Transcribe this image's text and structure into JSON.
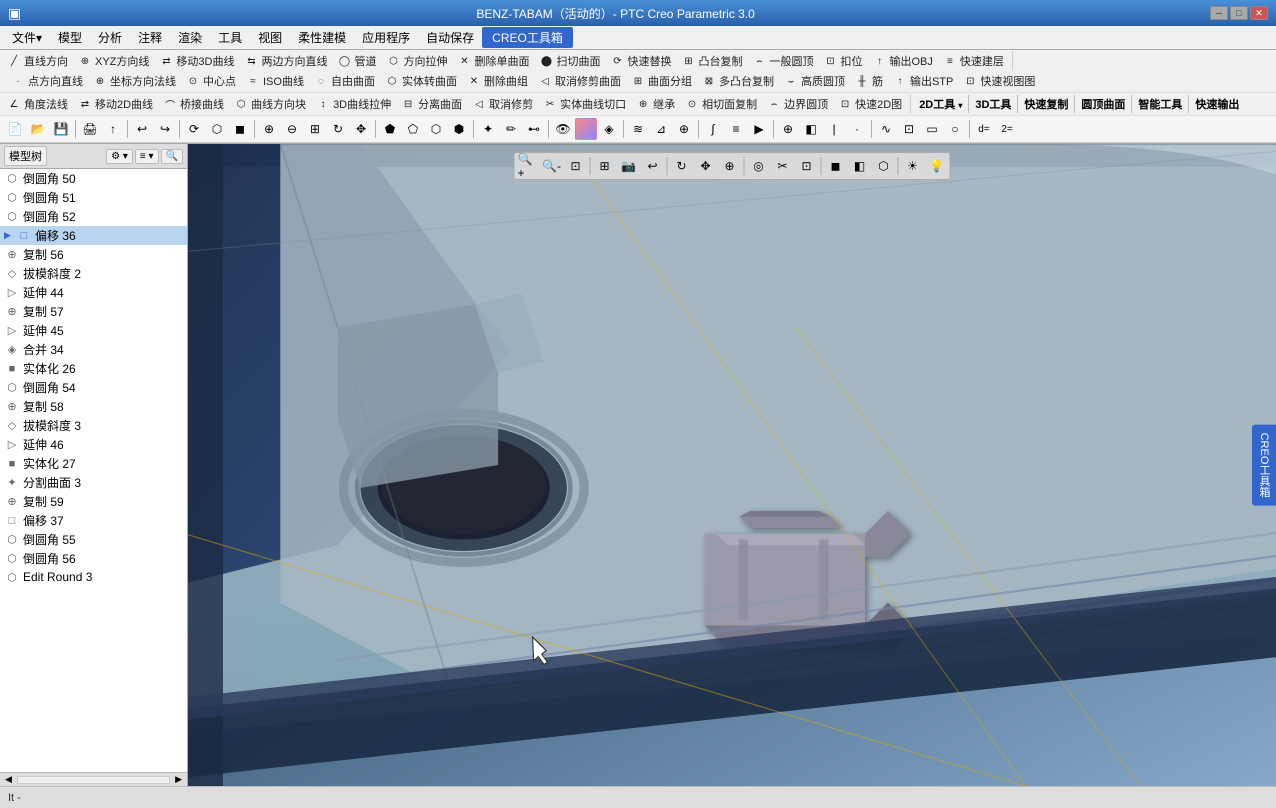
{
  "titlebar": {
    "title": "BENZ-TABAM（活动的）- PTC Creo Parametric 3.0",
    "icon": "▣"
  },
  "menubar": {
    "items": [
      "文件▾",
      "模型",
      "分析",
      "注释",
      "渲染",
      "工具",
      "视图",
      "柔性建模",
      "应用程序",
      "自动保存",
      "CREO工具箱"
    ]
  },
  "toolbar": {
    "row1": {
      "section_2d": "2D工具",
      "section_3d": "3D工具",
      "section_copy": "快速复制",
      "section_curve": "圆顶曲面",
      "section_smart": "智能工具",
      "section_output": "快速输出",
      "tools_2d": [
        "直线方向",
        "XYZ方向线",
        "移动3D曲线",
        "两边方向直线",
        "管道",
        "方向拉伸",
        "删除单曲面",
        "扫切曲面",
        "快速替换",
        "凸台复制",
        "一般圆顶",
        "扣位",
        "输出OBJ",
        "快速建层",
        "点方向直线",
        "坐标方向法线",
        "中心点",
        "ISO曲线",
        "自由曲面",
        "实体转曲面",
        "删除曲组",
        "取消修剪曲面",
        "曲面分组",
        "多凸台复制",
        "高质圆顶",
        "筋",
        "输出STP",
        "快速视图图",
        "角度法线",
        "移动2D曲线",
        "桥接曲线",
        "曲线方向块",
        "3D曲线拉伸",
        "分离曲面",
        "取消修剪",
        "实体曲线切口",
        "继承",
        "相切面复制",
        "边界圆顶",
        "快速2D图"
      ]
    },
    "row2_icons": [
      "new",
      "open",
      "save",
      "print",
      "undo",
      "redo",
      "zoom_in",
      "zoom_out",
      "rotate",
      "pan",
      "wireframe",
      "shading"
    ]
  },
  "model_tree": {
    "label": "模型树",
    "items": [
      {
        "id": "chamfer50",
        "label": "倒圆角 50",
        "icon": "⬡",
        "indent": 0
      },
      {
        "id": "chamfer51",
        "label": "倒圆角 51",
        "icon": "⬡",
        "indent": 0
      },
      {
        "id": "chamfer52",
        "label": "倒圆角 52",
        "icon": "⬡",
        "indent": 0
      },
      {
        "id": "offset36",
        "label": "偏移 36",
        "icon": "□",
        "indent": 0,
        "active": true
      },
      {
        "id": "copy56",
        "label": "复制 56",
        "icon": "⊕",
        "indent": 0
      },
      {
        "id": "draft2",
        "label": "拔模斜度 2",
        "icon": "◇",
        "indent": 0
      },
      {
        "id": "extrude44",
        "label": "延伸 44",
        "icon": "▷",
        "indent": 0
      },
      {
        "id": "copy57",
        "label": "复制 57",
        "icon": "⊕",
        "indent": 0
      },
      {
        "id": "extrude45",
        "label": "延伸 45",
        "icon": "▷",
        "indent": 0
      },
      {
        "id": "merge34",
        "label": "合并 34",
        "icon": "◈",
        "indent": 0
      },
      {
        "id": "solid26",
        "label": "实体化 26",
        "icon": "■",
        "indent": 0
      },
      {
        "id": "chamfer54",
        "label": "倒圆角 54",
        "icon": "⬡",
        "indent": 0
      },
      {
        "id": "copy58",
        "label": "复制 58",
        "icon": "⊕",
        "indent": 0
      },
      {
        "id": "draft3",
        "label": "拔模斜度 3",
        "icon": "◇",
        "indent": 0
      },
      {
        "id": "extrude46",
        "label": "延伸 46",
        "icon": "▷",
        "indent": 0
      },
      {
        "id": "solid27",
        "label": "实体化 27",
        "icon": "■",
        "indent": 0
      },
      {
        "id": "split3",
        "label": "分割曲面 3",
        "icon": "✦",
        "indent": 0
      },
      {
        "id": "copy59",
        "label": "复制 59",
        "icon": "⊕",
        "indent": 0
      },
      {
        "id": "offset37",
        "label": "偏移 37",
        "icon": "□",
        "indent": 0
      },
      {
        "id": "chamfer55",
        "label": "倒圆角 55",
        "icon": "⬡",
        "indent": 0
      },
      {
        "id": "chamfer56",
        "label": "倒圆角 56",
        "icon": "⬡",
        "indent": 0
      },
      {
        "id": "editround3",
        "label": "Edit Round 3",
        "icon": "⬡",
        "indent": 0
      }
    ]
  },
  "viewport": {
    "bg_color": "#3a5a7a"
  },
  "view_toolbar": {
    "buttons": [
      "🔍+",
      "🔍-",
      "⊡",
      "▣",
      "◫",
      "⬚",
      "⬛",
      "▷",
      "↔",
      "↕",
      "⟳",
      "⊞",
      "⊟",
      "⊠",
      "⊕",
      "⊗",
      "⊘",
      "⊙",
      "⊚",
      "⊛",
      "⊜"
    ]
  },
  "statusbar": {
    "text": "It -"
  },
  "creo_tab": "CREO工具箱",
  "colors": {
    "accent": "#3366cc",
    "bg_toolbar": "#f0f0f0",
    "bg_tree": "#ffffff",
    "bg_viewport": "#4a6a8a",
    "title_bg": "#2a5faa"
  }
}
